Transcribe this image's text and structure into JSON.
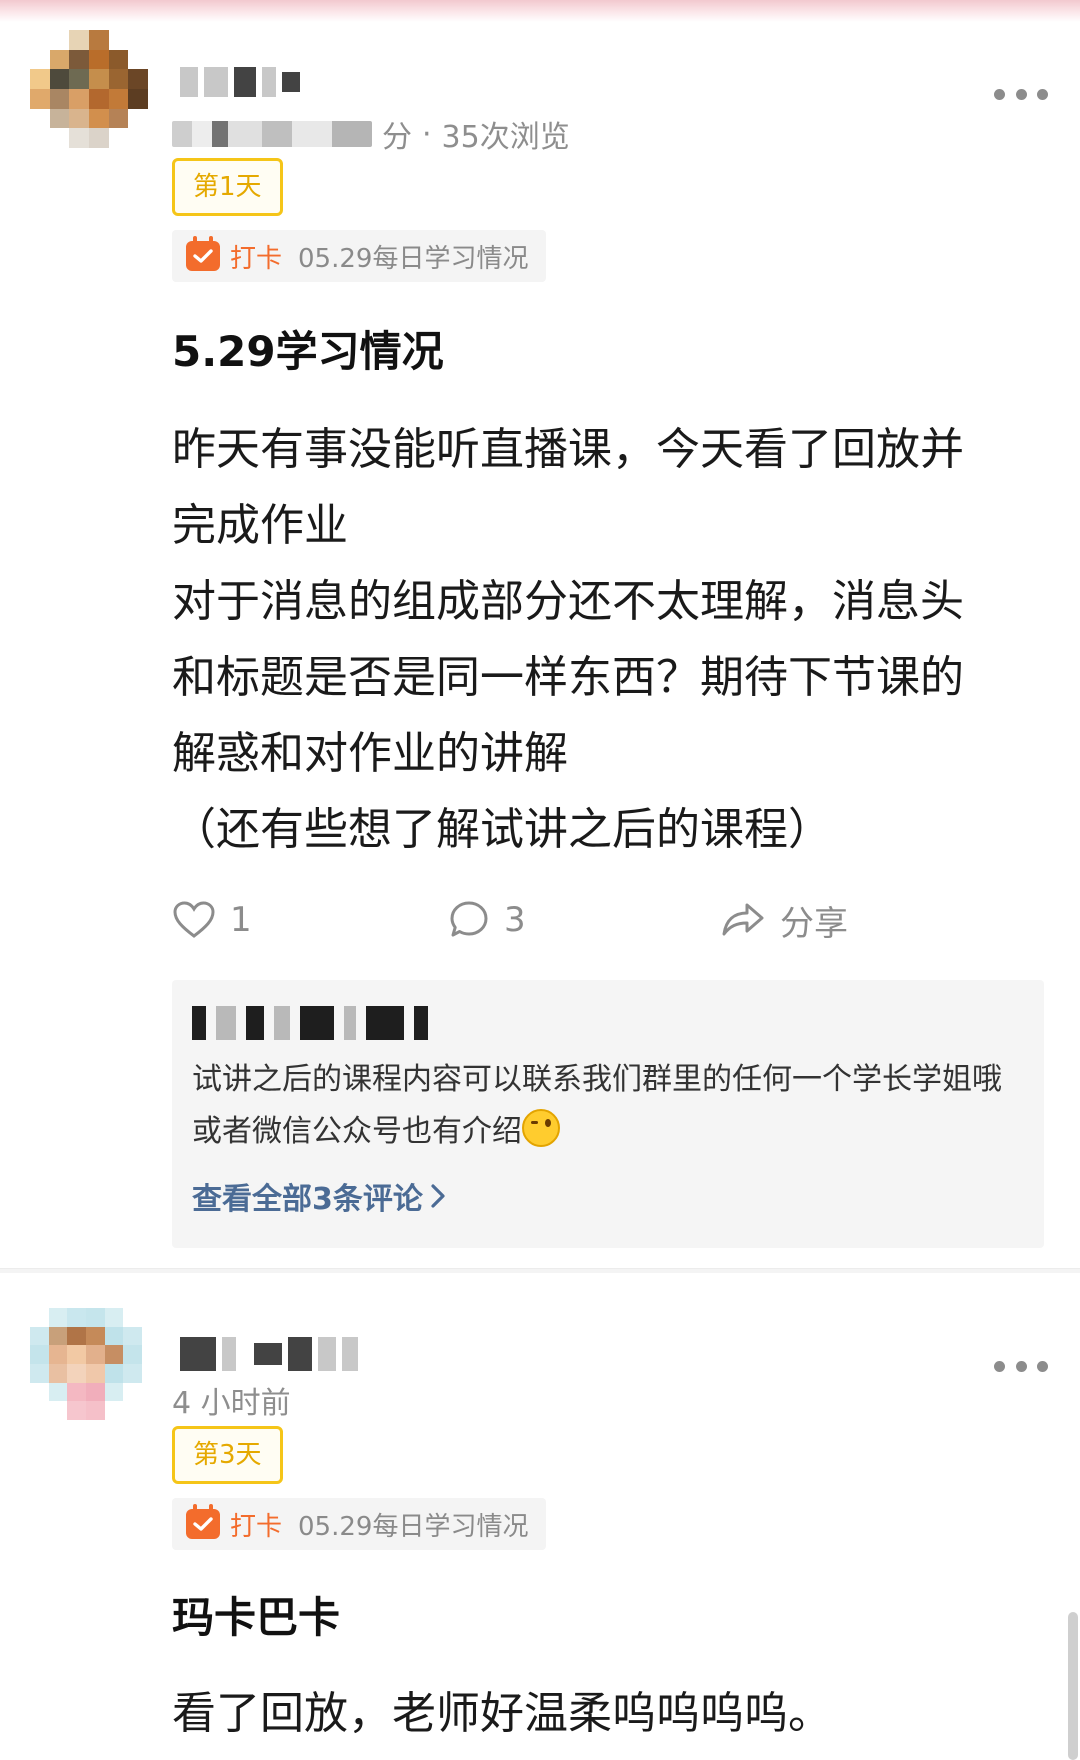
{
  "posts": [
    {
      "author_masked": true,
      "meta": {
        "time_masked": true,
        "time_suffix": "分",
        "separator": "·",
        "views": "35次浏览"
      },
      "day_badge": "第1天",
      "checkin": {
        "label": "打卡",
        "topic": "05.29每日学习情况"
      },
      "title": "5.29学习情况",
      "body": "昨天有事没能听直播课，今天看了回放并\n完成作业\n对于消息的组成部分还不太理解，消息头\n和标题是否是同一样东西？期待下节课的\n解惑和对作业的讲解\n（还有些想了解试讲之后的课程）",
      "actions": {
        "likes": "1",
        "comments": "3",
        "share": "分享"
      },
      "comment_preview": {
        "author_masked": true,
        "text": "试讲之后的课程内容可以联系我们群里的任何一个学长学姐哦 或者微信公众号也有介绍",
        "emoji": "wink-emoji",
        "view_all": "查看全部3条评论"
      }
    },
    {
      "author_masked": true,
      "meta": {
        "time": "4 小时前"
      },
      "day_badge": "第3天",
      "checkin": {
        "label": "打卡",
        "topic": "05.29每日学习情况"
      },
      "title": "玛卡巴卡",
      "body": "看了回放，老师好温柔呜呜呜呜。"
    }
  ],
  "colors": {
    "accent_orange": "#f36c2c",
    "badge_yellow": "#f5c518",
    "link_blue": "#4b6b95",
    "muted_gray": "#8c8c8c"
  },
  "icons": [
    "more-icon",
    "calendar-check-icon",
    "heart-icon",
    "comment-icon",
    "share-icon",
    "chevron-right-icon"
  ]
}
